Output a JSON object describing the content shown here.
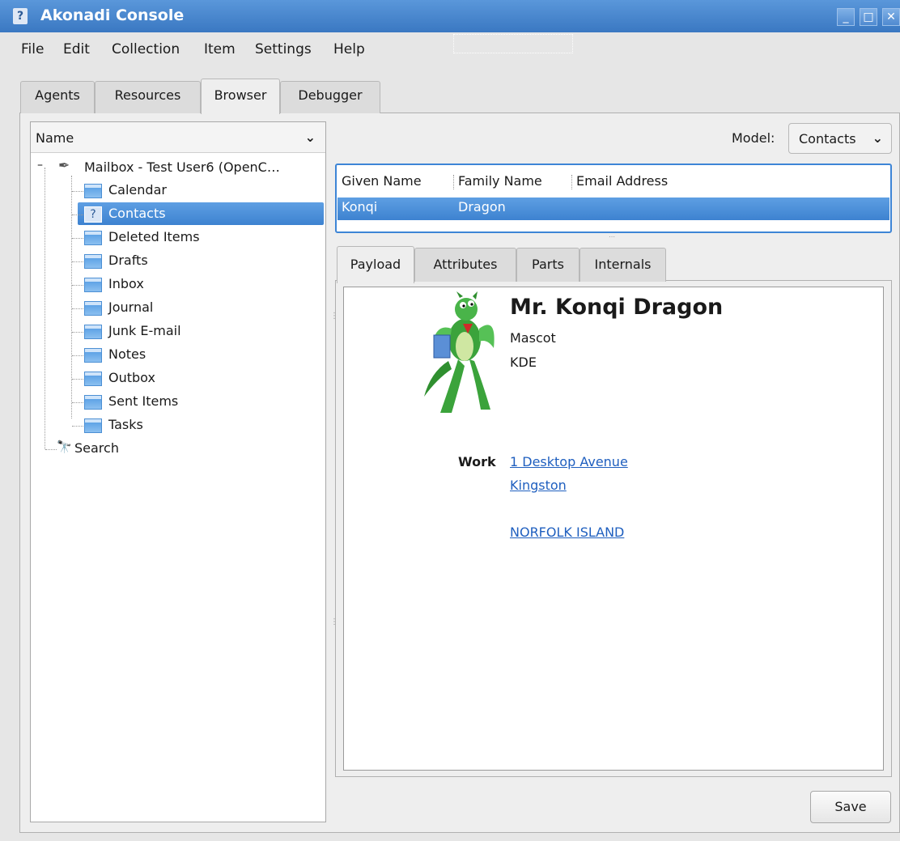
{
  "window": {
    "title": "Akonadi Console"
  },
  "menubar": [
    "File",
    "Edit",
    "Collection",
    "Item",
    "Settings",
    "Help"
  ],
  "main_tabs": [
    "Agents",
    "Resources",
    "Browser",
    "Debugger"
  ],
  "main_tabs_active": "Browser",
  "collection_tree": {
    "header": "Name",
    "root": "Mailbox - Test User6 (OpenC…",
    "folders": [
      "Calendar",
      "Contacts",
      "Deleted Items",
      "Drafts",
      "Inbox",
      "Journal",
      "Junk E-mail",
      "Notes",
      "Outbox",
      "Sent Items",
      "Tasks"
    ],
    "selected": "Contacts",
    "search": "Search"
  },
  "model": {
    "label": "Model:",
    "value": "Contacts"
  },
  "items_table": {
    "columns": [
      "Given Name",
      "Family Name",
      "Email Address"
    ],
    "rows": [
      {
        "given": "Konqi",
        "family": "Dragon",
        "email": ""
      }
    ]
  },
  "sub_tabs": [
    "Payload",
    "Attributes",
    "Parts",
    "Internals"
  ],
  "sub_tabs_active": "Payload",
  "contact": {
    "name": "Mr. Konqi Dragon",
    "role": "Mascot",
    "organization": "KDE",
    "address_label": "Work",
    "address_lines": [
      "1 Desktop Avenue",
      "Kingston",
      "",
      "NORFOLK ISLAND"
    ]
  },
  "save_label": "Save"
}
